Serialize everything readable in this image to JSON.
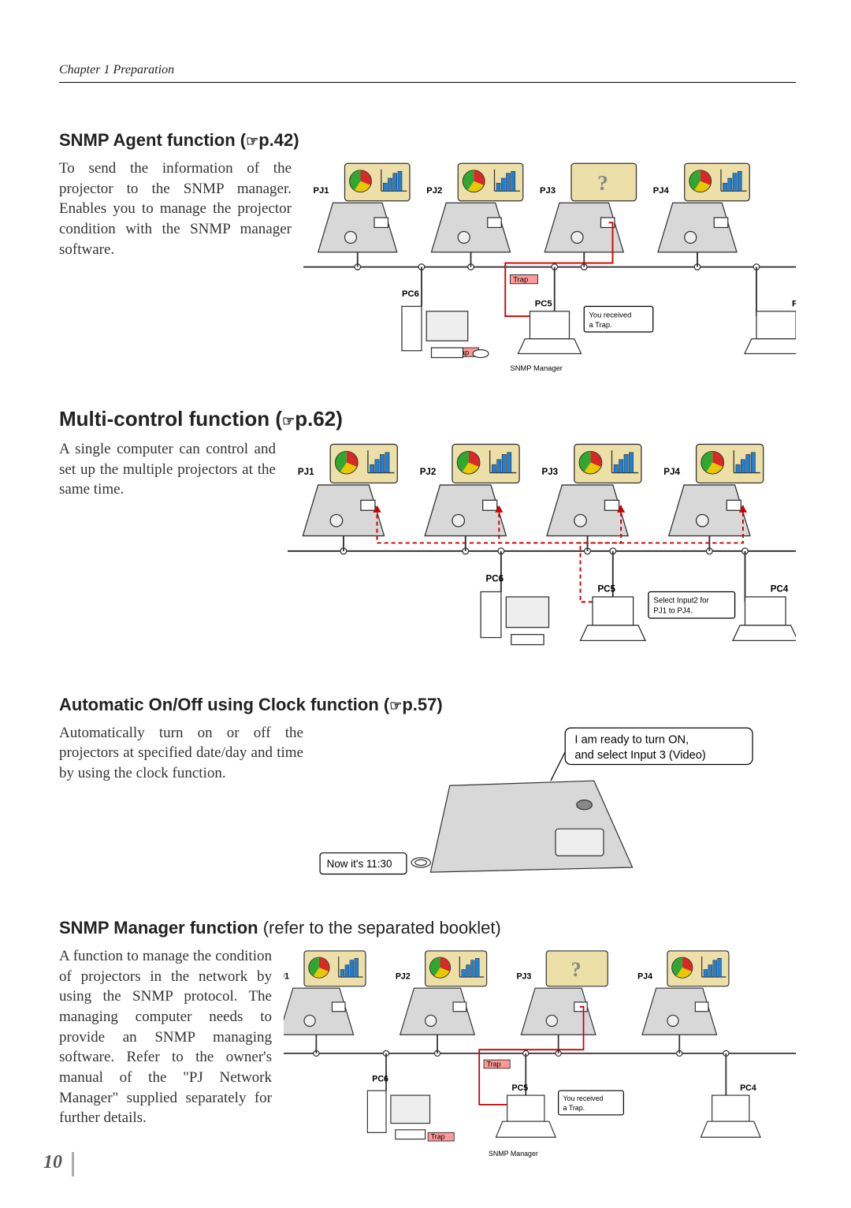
{
  "chapter": "Chapter 1 Preparation",
  "page_number": "10",
  "sections": [
    {
      "title_prefix": "SNMP Agent function (",
      "page_ref": "p.42",
      "title_suffix": ")",
      "body": "To send the information of the projector to the SNMP manager. Enables you to manage the projector condition with the SNMP manager software."
    },
    {
      "title_prefix": "Multi-control function (",
      "page_ref": "p.62",
      "title_suffix": ")",
      "body": "A single computer can control and set up the multiple projectors at the same time."
    },
    {
      "title_prefix": "Automatic On/Off using Clock function (",
      "page_ref": "p.57",
      "title_suffix": ")",
      "body": "Automatically turn on or off the projectors at specified date/day and time by using the clock function."
    },
    {
      "title_prefix": "SNMP Manager function ",
      "page_ref": "(refer to the separated booklet)",
      "title_suffix": "",
      "body": "A function to manage the condition of projectors in the network by using the SNMP protocol. The managing computer needs to provide an SNMP managing software. Refer to the owner's manual of the \"PJ Network Manager\" supplied separately for further details."
    }
  ],
  "diagram_labels": {
    "projectors": [
      "PJ1",
      "PJ2",
      "PJ3",
      "PJ4"
    ],
    "pcs": [
      "PC4",
      "PC5",
      "PC6"
    ],
    "snmp_manager": "SNMP Manager",
    "trap": "Trap",
    "trap_callout": {
      "line1": "You received",
      "line2": "a Trap."
    },
    "multi_callout": {
      "line1": "Select Input2 for",
      "line2": "PJ1 to PJ4."
    },
    "clock_callout": {
      "line1": "I am ready to turn ON,",
      "line2": "and select Input 3 (Video)"
    },
    "clock_time": "Now it's 11:30",
    "question": "?"
  }
}
